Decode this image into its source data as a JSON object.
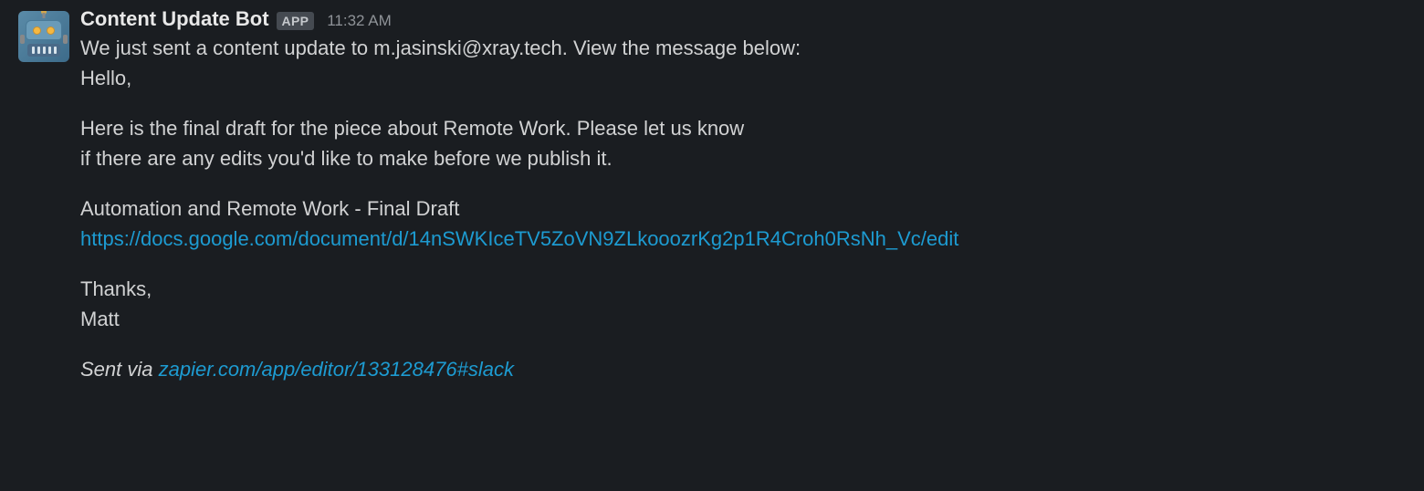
{
  "sender": {
    "name": "Content Update Bot",
    "badge": "APP",
    "timestamp": "11:32 AM"
  },
  "message": {
    "intro": "We just sent a content update to m.jasinski@xray.tech. View the message below:",
    "greeting": "Hello,",
    "body_line1": "Here is the final draft for the piece about Remote Work. Please let us know",
    "body_line2": "if there are any edits you'd like to make before we publish it.",
    "doc_title": "Automation and Remote Work - Final Draft",
    "doc_link": "https://docs.google.com/document/d/14nSWKIceTV5ZoVN9ZLkooozrKg2p1R4Croh0RsNh_Vc/edit",
    "signoff": "Thanks,",
    "signature": "Matt",
    "sent_via_prefix": "Sent via ",
    "sent_via_link": "zapier.com/app/editor/133128476#slack"
  }
}
